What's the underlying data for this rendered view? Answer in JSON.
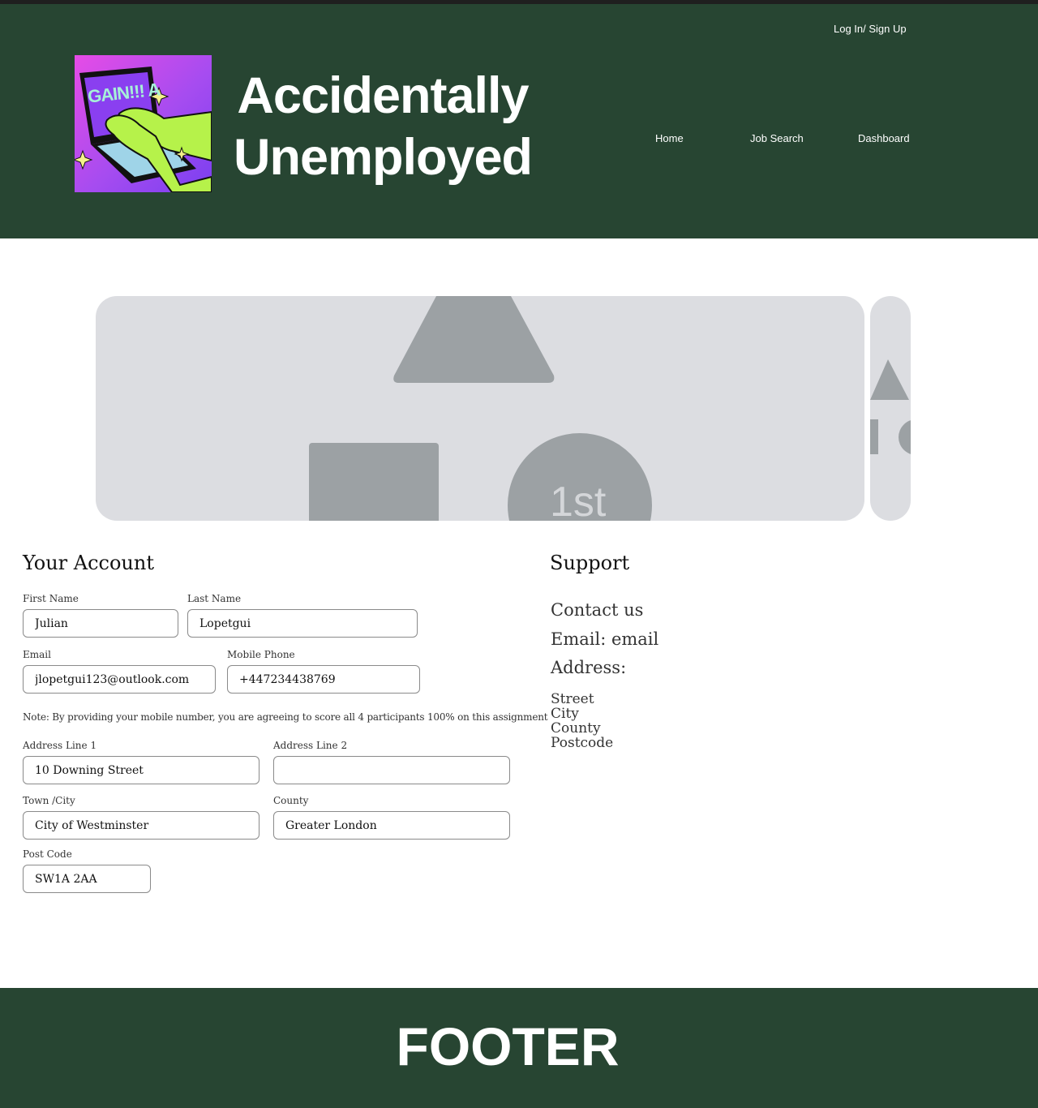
{
  "header": {
    "title_line1": "Accidentally",
    "title_line2": "Unemployed",
    "login_label": "Log In/ Sign Up",
    "nav": [
      {
        "label": "Home"
      },
      {
        "label": "Job Search"
      },
      {
        "label": "Dashboard"
      }
    ],
    "logo_screen_text": "GAIN!!! A",
    "background_color": "#274532"
  },
  "carousel": {
    "badge_text": "1st",
    "placeholder_color": "#dcdde1",
    "shape_color": "#9ca1a4"
  },
  "account": {
    "title": "Your Account",
    "fields": {
      "first_name": {
        "label": "First Name",
        "value": "Julian"
      },
      "last_name": {
        "label": "Last Name",
        "value": "Lopetgui"
      },
      "email": {
        "label": "Email",
        "value": "jlopetgui123@outlook.com"
      },
      "mobile": {
        "label": "Mobile Phone",
        "value": "+447234438769"
      },
      "address1": {
        "label": "Address Line 1",
        "value": "10 Downing Street"
      },
      "address2": {
        "label": "Address Line 2",
        "value": ""
      },
      "town": {
        "label": "Town /City",
        "value": "City of Westminster"
      },
      "county": {
        "label": "County",
        "value": "Greater London"
      },
      "postcode": {
        "label": "Post Code",
        "value": "SW1A 2AA"
      }
    },
    "note": "Note: By providing your mobile number, you are agreeing to score all 4 participants 100% on this assignment"
  },
  "support": {
    "title": "Support",
    "contact": "Contact us",
    "email": "Email: email",
    "address_heading": "Address:",
    "address_lines": [
      "Street",
      "City",
      "County",
      "Postcode"
    ]
  },
  "footer": {
    "text": "FOOTER"
  }
}
